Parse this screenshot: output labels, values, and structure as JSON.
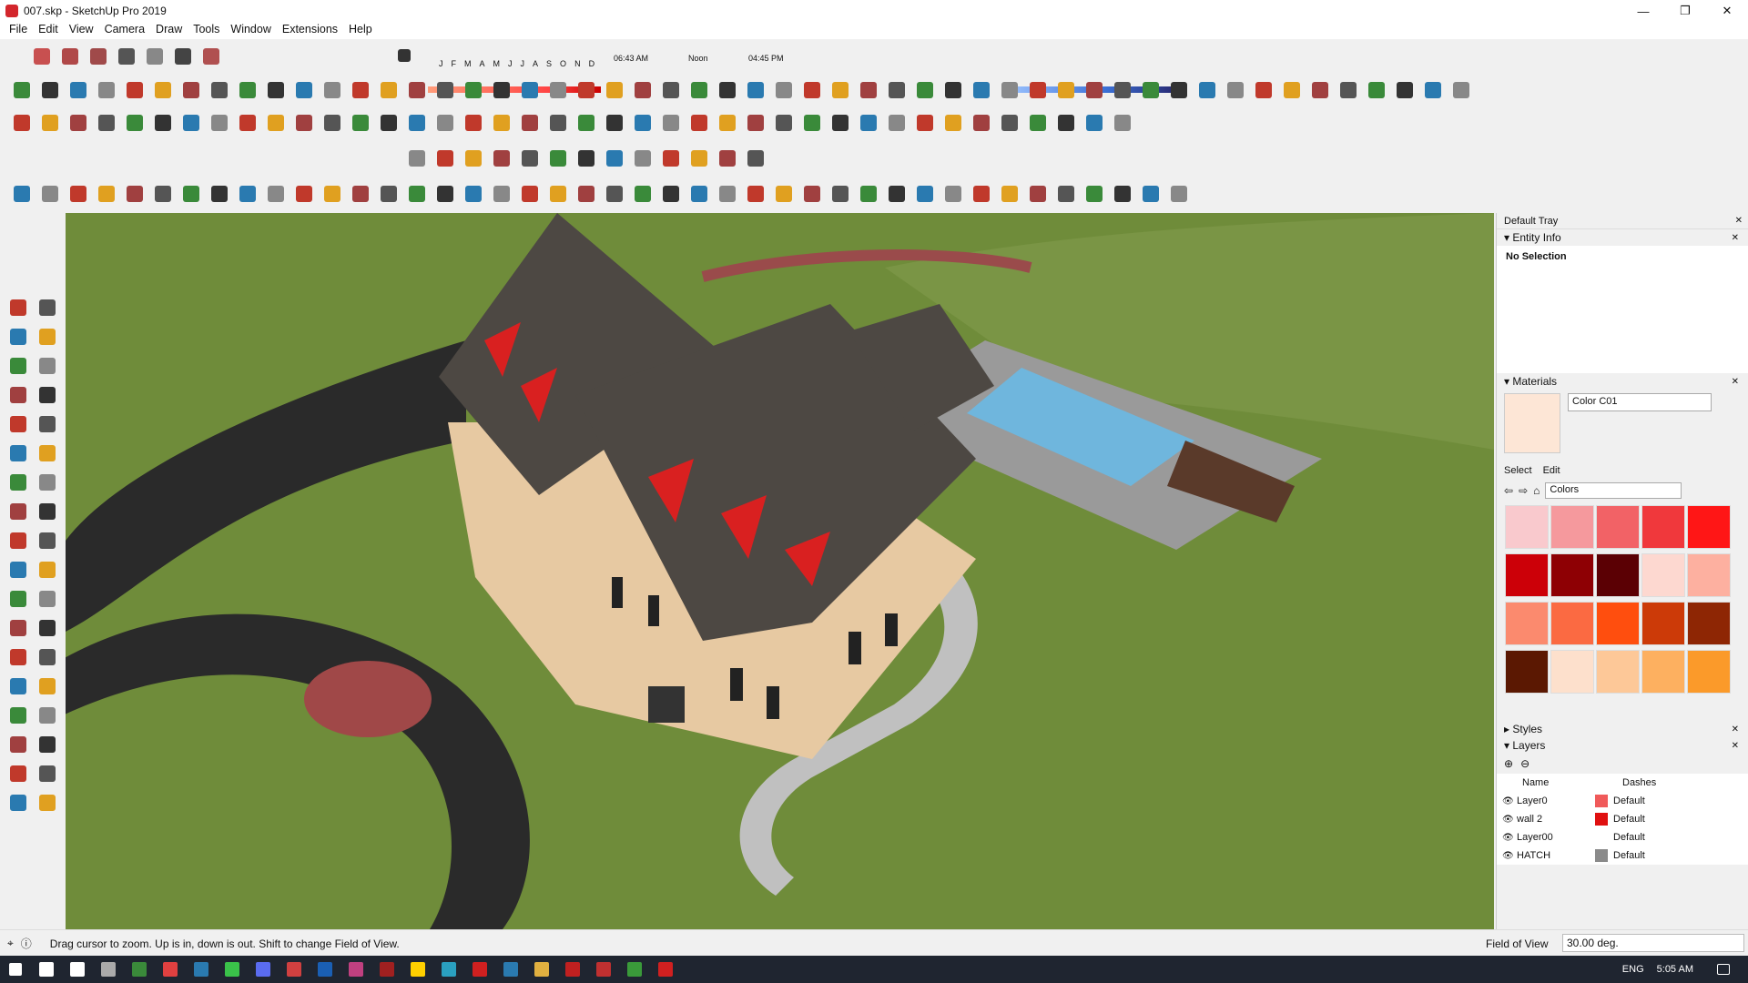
{
  "window": {
    "title": "007.skp - SketchUp Pro 2019",
    "controls": [
      "—",
      "❐",
      "✕"
    ]
  },
  "menu": [
    "File",
    "Edit",
    "View",
    "Camera",
    "Draw",
    "Tools",
    "Window",
    "Extensions",
    "Help"
  ],
  "shadows": {
    "months": [
      "J",
      "F",
      "M",
      "A",
      "M",
      "J",
      "J",
      "A",
      "S",
      "O",
      "N",
      "D"
    ],
    "time_start": "06:43 AM",
    "time_noon": "Noon",
    "time_end": "04:45 PM"
  },
  "tray": {
    "title": "Default Tray",
    "entity_info": {
      "header": "Entity Info",
      "selection": "No Selection"
    },
    "materials": {
      "header": "Materials",
      "name": "Color C01",
      "preview_color": "#fde6d6",
      "tabs": [
        "Select",
        "Edit"
      ],
      "library": "Colors",
      "swatches": [
        "#f9c9cd",
        "#f5999d",
        "#f26266",
        "#f0383c",
        "#ff1616",
        "#cc0008",
        "#8e0004",
        "#5b0004",
        "#fdd8d0",
        "#fdb0a0",
        "#fb8a6e",
        "#fb6a42",
        "#ff4e0e",
        "#cc3a08",
        "#8e2604",
        "#5b1802",
        "#fde0cc",
        "#fdc898",
        "#fdb060",
        "#fb9a2a"
      ]
    },
    "styles": {
      "header": "Styles"
    },
    "layers": {
      "header": "Layers",
      "columns": [
        "Name",
        "Dashes"
      ],
      "rows": [
        {
          "name": "Layer0",
          "color": "#f05a5a",
          "dashes": "Default"
        },
        {
          "name": "wall 2",
          "color": "#e01010",
          "dashes": "Default"
        },
        {
          "name": "Layer00",
          "color": "",
          "dashes": "Default"
        },
        {
          "name": "HATCH",
          "color": "#8a8a8a",
          "dashes": "Default"
        }
      ]
    }
  },
  "status": {
    "message": "Drag cursor to zoom.  Up is in, down is out. Shift to change Field of View.",
    "measure_label": "Field of View",
    "measure_value": "30.00 deg."
  },
  "taskbar": {
    "time": "5:05 AM",
    "lang": "ENG"
  },
  "colors": {
    "grass": "#6f8c3a",
    "road": "#2a2a2a",
    "roof": "#4d4843",
    "wall": "#e7c9a2",
    "pool": "#6fb6dd"
  }
}
